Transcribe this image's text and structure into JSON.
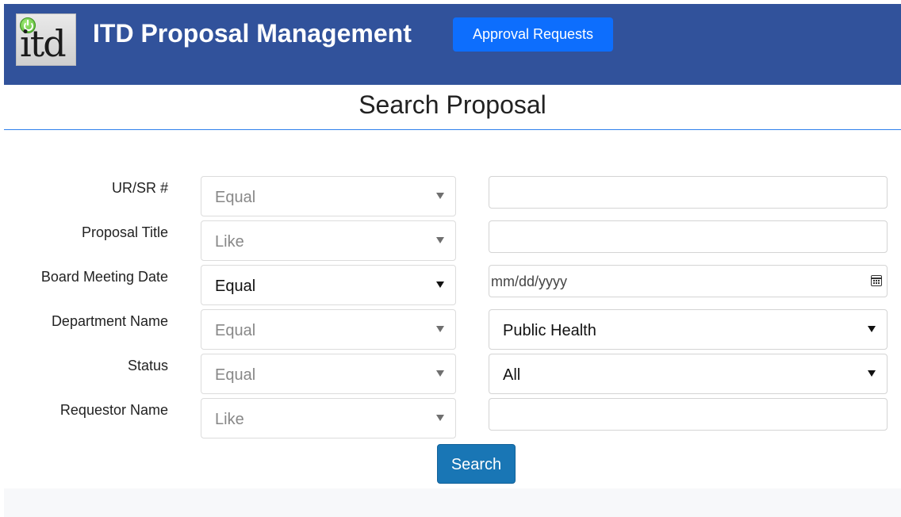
{
  "header": {
    "logo_text": "itd",
    "app_title": "ITD Proposal Management",
    "approval_button": "Approval Requests"
  },
  "page": {
    "title": "Search Proposal"
  },
  "form": {
    "rows": [
      {
        "label": "UR/SR #",
        "operator": "Equal",
        "value": ""
      },
      {
        "label": "Proposal Title",
        "operator": "Like",
        "value": ""
      },
      {
        "label": "Board Meeting Date",
        "operator": "Equal",
        "value_placeholder": "mm/dd/yyyy"
      },
      {
        "label": "Department Name",
        "operator": "Equal",
        "value": "Public Health"
      },
      {
        "label": "Status",
        "operator": "Equal",
        "value": "All"
      },
      {
        "label": "Requestor Name",
        "operator": "Like",
        "value": ""
      }
    ],
    "search_button": "Search"
  },
  "colors": {
    "header_bg": "#31529b",
    "primary_button": "#0d6efd",
    "search_button": "#1976b5",
    "divider": "#2f80ed"
  },
  "icons": {
    "logo": "power-icon",
    "date_picker": "calendar-icon",
    "dropdown": "caret-down-icon"
  }
}
